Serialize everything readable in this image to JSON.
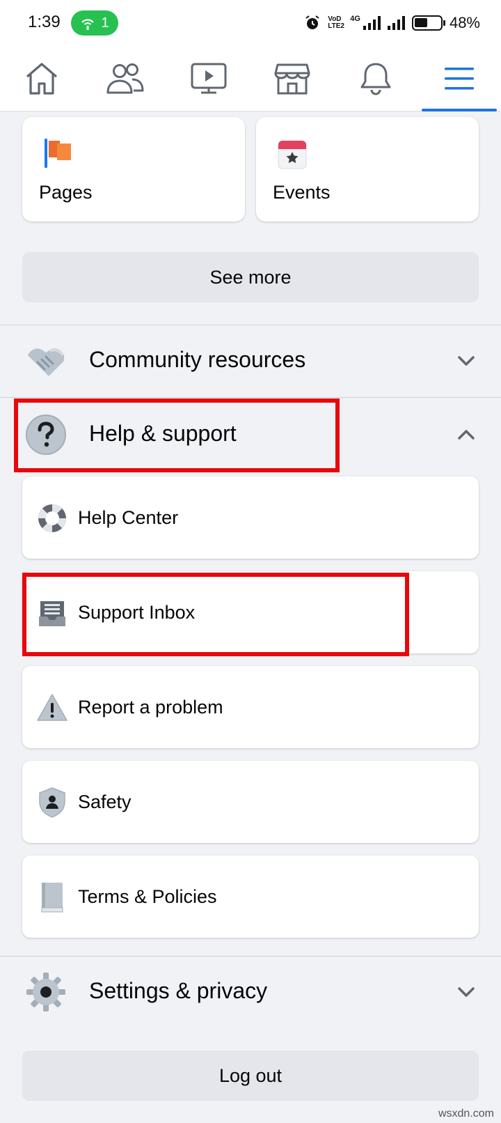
{
  "status_bar": {
    "time": "1:39",
    "hotspot_count": "1",
    "network_label": "VoD LTE2",
    "network_type": "4G",
    "battery_percent": "48%"
  },
  "top_nav": {
    "items": [
      {
        "icon": "home-icon"
      },
      {
        "icon": "friends-icon"
      },
      {
        "icon": "watch-icon"
      },
      {
        "icon": "marketplace-icon"
      },
      {
        "icon": "notifications-icon"
      },
      {
        "icon": "menu-icon",
        "active": true
      }
    ],
    "active_color": "#1b74e4"
  },
  "shortcuts": {
    "pages_label": "Pages",
    "events_label": "Events"
  },
  "see_more_label": "See more",
  "sections": {
    "community_resources": {
      "label": "Community resources",
      "expanded": false
    },
    "help_support": {
      "label": "Help & support",
      "expanded": true
    },
    "settings_privacy": {
      "label": "Settings & privacy",
      "expanded": false
    }
  },
  "help_items": [
    {
      "label": "Help Center",
      "icon": "lifebuoy-icon"
    },
    {
      "label": "Support Inbox",
      "icon": "inbox-icon"
    },
    {
      "label": "Report a problem",
      "icon": "warning-icon"
    },
    {
      "label": "Safety",
      "icon": "shield-icon"
    },
    {
      "label": "Terms & Policies",
      "icon": "book-icon"
    }
  ],
  "logout_label": "Log out",
  "highlight_color": "#e8070d",
  "watermark": "wsxdn.com"
}
